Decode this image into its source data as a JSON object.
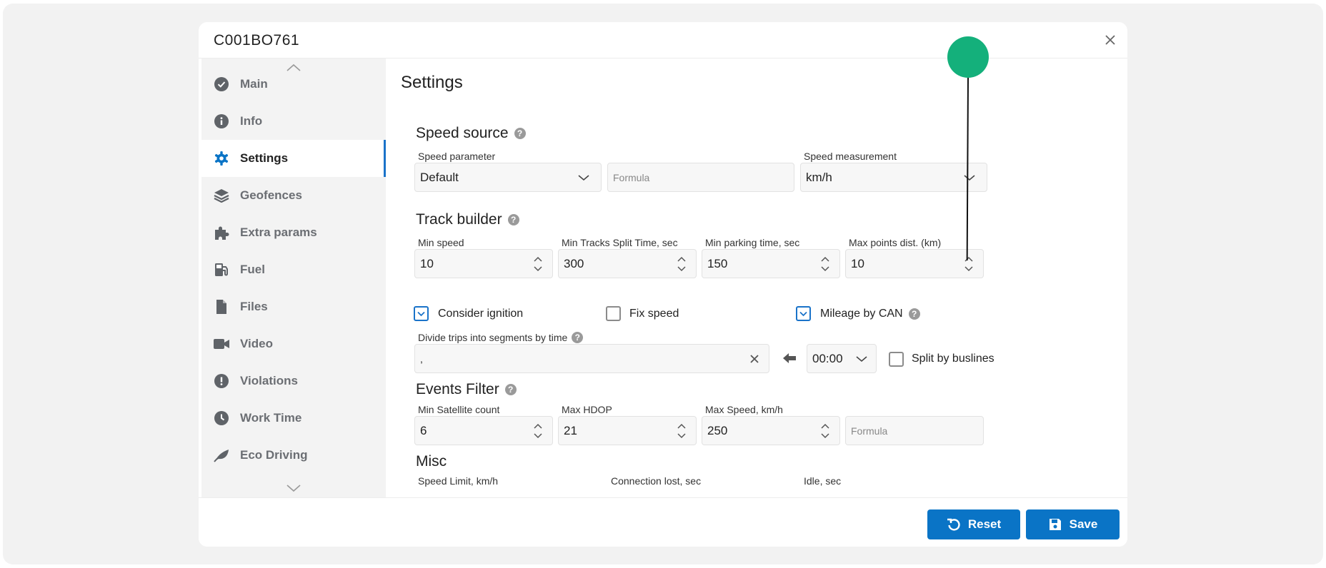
{
  "modal": {
    "title": "C001BO761"
  },
  "sidebar": {
    "items": [
      {
        "label": "Main",
        "icon": "check-circle-icon"
      },
      {
        "label": "Info",
        "icon": "info-icon"
      },
      {
        "label": "Settings",
        "icon": "gear-icon",
        "active": true
      },
      {
        "label": "Geofences",
        "icon": "layers-icon"
      },
      {
        "label": "Extra params",
        "icon": "puzzle-icon"
      },
      {
        "label": "Fuel",
        "icon": "fuel-pump-icon"
      },
      {
        "label": "Files",
        "icon": "file-icon"
      },
      {
        "label": "Video",
        "icon": "video-camera-icon"
      },
      {
        "label": "Violations",
        "icon": "exclamation-circle-icon"
      },
      {
        "label": "Work Time",
        "icon": "clock-icon"
      },
      {
        "label": "Eco Driving",
        "icon": "leaf-icon"
      }
    ]
  },
  "content": {
    "title": "Settings",
    "speed_source": {
      "title": "Speed source",
      "speed_parameter_label": "Speed parameter",
      "speed_parameter_value": "Default",
      "formula_placeholder": "Formula",
      "speed_measurement_label": "Speed measurement",
      "speed_measurement_value": "km/h"
    },
    "track_builder": {
      "title": "Track builder",
      "min_speed_label": "Min speed",
      "min_speed_value": "10",
      "split_time_label": "Min Tracks Split Time, sec",
      "split_time_value": "300",
      "parking_time_label": "Min parking time, sec",
      "parking_time_value": "150",
      "max_points_label": "Max points dist. (km)",
      "max_points_value": "10",
      "consider_ignition_label": "Consider ignition",
      "consider_ignition_checked": true,
      "fix_speed_label": "Fix speed",
      "fix_speed_checked": false,
      "mileage_can_label": "Mileage by CAN",
      "mileage_can_checked": true,
      "divide_trips_label": "Divide trips into segments by time",
      "divide_trips_value": ",",
      "time_value": "00:00",
      "split_buslines_label": "Split by buslines",
      "split_buslines_checked": false
    },
    "events_filter": {
      "title": "Events Filter",
      "min_satellite_label": "Min Satellite count",
      "min_satellite_value": "6",
      "max_hdop_label": "Max HDOP",
      "max_hdop_value": "21",
      "max_speed_label": "Max Speed, km/h",
      "max_speed_value": "250",
      "formula_placeholder": "Formula"
    },
    "misc": {
      "title": "Misc",
      "speed_limit_label": "Speed Limit, km/h",
      "connection_lost_label": "Connection lost, sec",
      "idle_label": "Idle, sec"
    }
  },
  "footer": {
    "reset_label": "Reset",
    "save_label": "Save"
  },
  "colors": {
    "accent": "#0a74c6",
    "marker": "#14b07b",
    "icon": "#5f6368"
  }
}
